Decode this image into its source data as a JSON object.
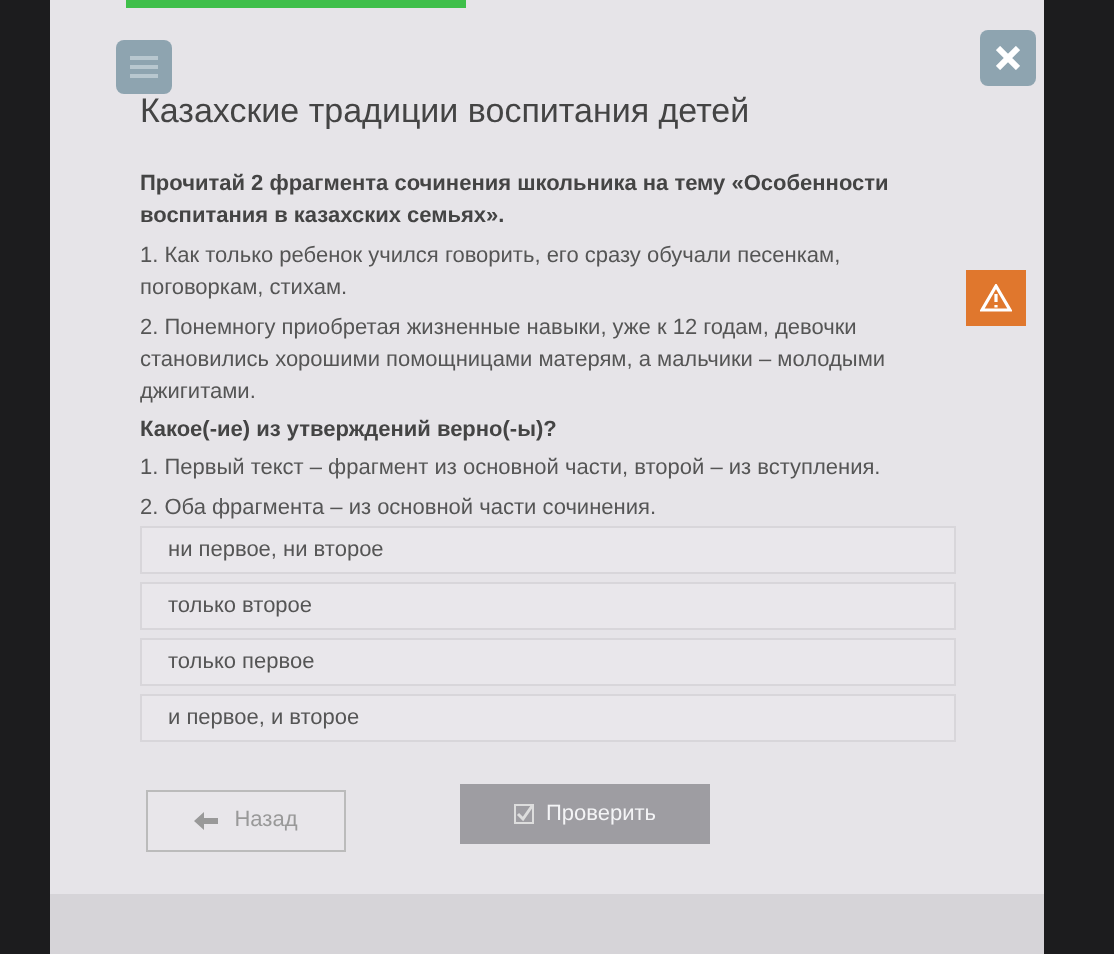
{
  "title": "Казахские традиции воспитания детей",
  "prompt": "Прочитай 2 фрагмента сочинения школьника на тему «Особенности воспитания в казахских семьях».",
  "fragments": [
    "1. Как только ребенок учился говорить, его сразу обучали песенкам, поговоркам, стихам.",
    "2. Понемногу приобретая жизненные навыки, уже к 12 годам, девочки становились хорошими помощницами матерям, а мальчики – молодыми джигитами."
  ],
  "question": "Какое(-ие) из утверждений верно(-ы)?",
  "statements": [
    "1. Первый текст – фрагмент из основной части, второй – из вступления.",
    "2. Оба фрагмента – из основной части сочинения."
  ],
  "options": [
    {
      "label": "ни первое, ни второе",
      "selected": false
    },
    {
      "label": "только второе",
      "selected": false
    },
    {
      "label": "только первое",
      "selected": false
    },
    {
      "label": "и первое, и второе",
      "selected": false
    }
  ],
  "back_button": {
    "label": "Назад"
  },
  "check_button": {
    "label": "Проверить",
    "disabled": true
  }
}
